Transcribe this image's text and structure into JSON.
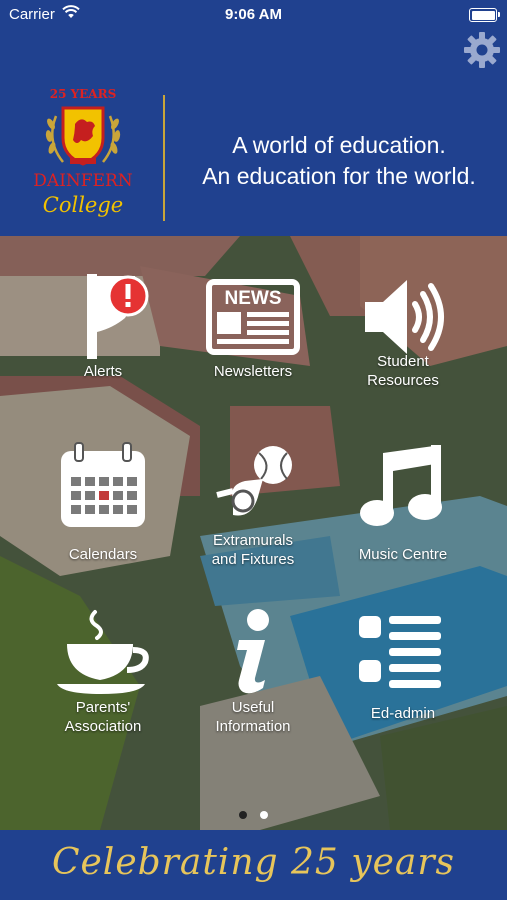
{
  "status_bar": {
    "carrier": "Carrier",
    "time": "9:06 AM"
  },
  "header": {
    "logo_top": "25 YEARS",
    "logo_name": "DAINFERN",
    "logo_college": "College",
    "tagline_line1": "A world of education.",
    "tagline_line2": "An education for the world."
  },
  "tiles": [
    {
      "label": "Alerts"
    },
    {
      "label": "Newsletters",
      "icon_text": "NEWS"
    },
    {
      "label_line1": "Student",
      "label_line2": "Resources"
    },
    {
      "label": "Calendars"
    },
    {
      "label_line1": "Extramurals",
      "label_line2": "and Fixtures"
    },
    {
      "label": "Music Centre"
    },
    {
      "label_line1": "Parents'",
      "label_line2": "Association"
    },
    {
      "label_line1": "Useful",
      "label_line2": "Information"
    },
    {
      "label": "Ed-admin"
    }
  ],
  "page_indicator": {
    "pages": 2,
    "current": 1
  },
  "footer": {
    "text": "Celebrating 25 years"
  },
  "colors": {
    "brand_blue": "#20418f",
    "gold": "#e7c55b",
    "alert_red": "#e53333"
  }
}
